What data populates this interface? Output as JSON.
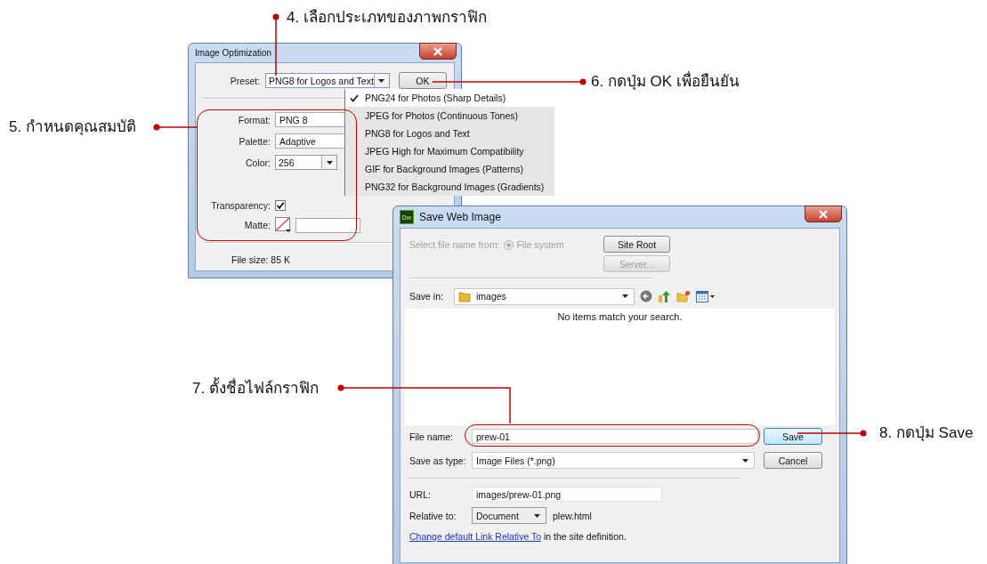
{
  "annotations": [
    {
      "text": "4. เลือกประเภทของภาพกราฟิก"
    },
    {
      "text": "5. กำหนดคุณสมบัติ"
    },
    {
      "text": "6. กดปุ่ม OK เพื่อยืนยัน"
    },
    {
      "text": "7. ตั้งชื่อไฟล์กราฟิก"
    },
    {
      "text": "8. กดปุ่ม Save"
    }
  ],
  "image_optimization": {
    "title": "Image Optimization",
    "preset": {
      "label": "Preset:",
      "value": "PNG8 for Logos and Text"
    },
    "ok_button": "OK",
    "preset_menu": [
      {
        "label": "PNG24 for Photos (Sharp Details)",
        "selected": true
      },
      {
        "label": "JPEG for Photos (Continuous Tones)",
        "selected": false
      },
      {
        "label": "PNG8 for Logos and Text",
        "selected": false
      },
      {
        "label": "JPEG High for Maximum Compatibility",
        "selected": false
      },
      {
        "label": "GIF for Background Images (Patterns)",
        "selected": false
      },
      {
        "label": "PNG32 for Background Images (Gradients)",
        "selected": false
      }
    ],
    "format": {
      "label": "Format:",
      "value": "PNG 8"
    },
    "palette": {
      "label": "Palette:",
      "value": "Adaptive"
    },
    "color": {
      "label": "Color:",
      "value": "256"
    },
    "transparency": {
      "label": "Transparency:",
      "checked": true
    },
    "matte": {
      "label": "Matte:"
    },
    "file_size": "File size: 85 K"
  },
  "save_dialog": {
    "title": "Save Web Image",
    "app_icon_text": "Dw",
    "select_from": {
      "label": "Select file name from:",
      "option": "File system",
      "disabled": true,
      "selected": true
    },
    "site_root_button": {
      "label": "Site Root",
      "disabled": false
    },
    "server_button": {
      "label": "Server...",
      "disabled": true
    },
    "save_in": {
      "label": "Save in:",
      "value": "images"
    },
    "empty_message": "No items match your search.",
    "file_name": {
      "label": "File name:",
      "value": "prew-01"
    },
    "save_as_type": {
      "label": "Save as type:",
      "value": "Image Files (*.png)"
    },
    "save_button": "Save",
    "cancel_button": "Cancel",
    "url": {
      "label": "URL:",
      "value": "images/prew-01.png"
    },
    "relative_to": {
      "label": "Relative to:",
      "value": "Document"
    },
    "relative_file": "plew.html",
    "link": "Change default Link Relative To",
    "link_suffix": "in the site definition."
  }
}
